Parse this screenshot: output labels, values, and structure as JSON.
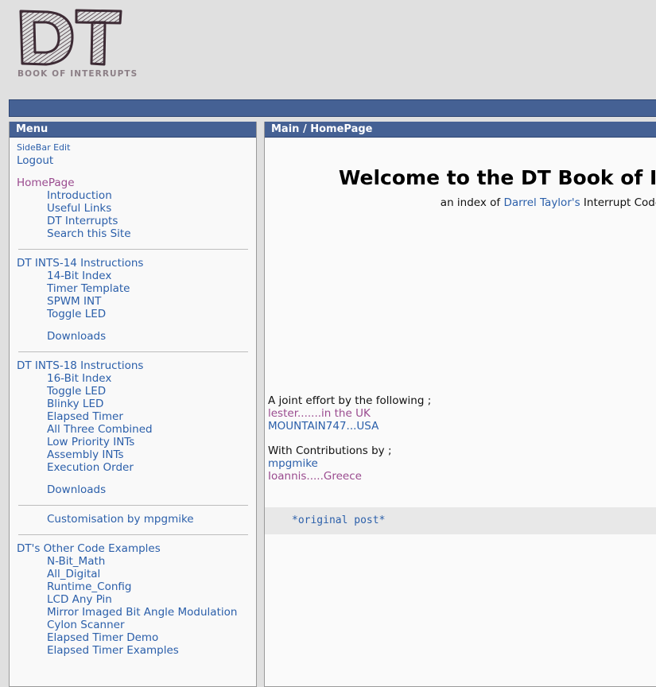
{
  "logo": {
    "mark_text": "DT",
    "tagline": "BOOK OF INTERRUPTS",
    "ink_color": "#3d2b35",
    "tagline_color": "#8c7f86"
  },
  "theme": {
    "page_background": "#e0e0e0",
    "bar_blue": "#456194",
    "bar_border": "#2f4672",
    "panel_background": "#f9f9f9",
    "link_blue": "#2b5faa",
    "link_visited_purple": "#9a4b8f",
    "code_background": "#e8e8e8"
  },
  "sidebar": {
    "title": "Menu",
    "groups": [
      {
        "items": [
          {
            "label": "SideBar Edit",
            "style": "small",
            "indent": false,
            "visited": false
          },
          {
            "label": "Logout",
            "style": "normal",
            "indent": false,
            "visited": false
          },
          {
            "label": "",
            "style": "spacer",
            "indent": false,
            "visited": false
          },
          {
            "label": "HomePage",
            "style": "normal",
            "indent": false,
            "visited": true
          },
          {
            "label": "Introduction",
            "style": "normal",
            "indent": true,
            "visited": false
          },
          {
            "label": "Useful Links",
            "style": "normal",
            "indent": true,
            "visited": false
          },
          {
            "label": "DT Interrupts",
            "style": "normal",
            "indent": true,
            "visited": false
          },
          {
            "label": "Search this Site",
            "style": "normal",
            "indent": true,
            "visited": false
          }
        ]
      },
      {
        "items": [
          {
            "label": "DT INTS-14 Instructions",
            "style": "normal",
            "indent": false,
            "visited": false
          },
          {
            "label": "14-Bit Index",
            "style": "normal",
            "indent": true,
            "visited": false
          },
          {
            "label": "Timer Template",
            "style": "normal",
            "indent": true,
            "visited": false
          },
          {
            "label": "SPWM INT",
            "style": "normal",
            "indent": true,
            "visited": false
          },
          {
            "label": "Toggle LED",
            "style": "normal",
            "indent": true,
            "visited": false
          },
          {
            "label": "",
            "style": "spacer",
            "indent": false,
            "visited": false
          },
          {
            "label": "Downloads",
            "style": "normal",
            "indent": true,
            "visited": false
          }
        ]
      },
      {
        "items": [
          {
            "label": "DT INTS-18 Instructions",
            "style": "normal",
            "indent": false,
            "visited": false
          },
          {
            "label": "16-Bit Index",
            "style": "normal",
            "indent": true,
            "visited": false
          },
          {
            "label": "Toggle LED",
            "style": "normal",
            "indent": true,
            "visited": false
          },
          {
            "label": "Blinky LED",
            "style": "normal",
            "indent": true,
            "visited": false
          },
          {
            "label": "Elapsed Timer",
            "style": "normal",
            "indent": true,
            "visited": false
          },
          {
            "label": "All Three Combined",
            "style": "normal",
            "indent": true,
            "visited": false
          },
          {
            "label": "Low Priority INTs",
            "style": "normal",
            "indent": true,
            "visited": false
          },
          {
            "label": "Assembly INTs",
            "style": "normal",
            "indent": true,
            "visited": false
          },
          {
            "label": "Execution Order",
            "style": "normal",
            "indent": true,
            "visited": false
          },
          {
            "label": "",
            "style": "spacer",
            "indent": false,
            "visited": false
          },
          {
            "label": "Downloads",
            "style": "normal",
            "indent": true,
            "visited": false
          }
        ]
      },
      {
        "items": [
          {
            "label": "Customisation by mpgmike",
            "style": "normal",
            "indent": true,
            "visited": false
          }
        ]
      },
      {
        "items": [
          {
            "label": "DT's Other Code Examples",
            "style": "normal",
            "indent": false,
            "visited": false
          },
          {
            "label": "N-Bit_Math",
            "style": "normal",
            "indent": true,
            "visited": false
          },
          {
            "label": "All_Digital",
            "style": "normal",
            "indent": true,
            "visited": false
          },
          {
            "label": "Runtime_Config",
            "style": "normal",
            "indent": true,
            "visited": false
          },
          {
            "label": "LCD Any Pin",
            "style": "normal",
            "indent": true,
            "visited": false
          },
          {
            "label": "Mirror Imaged Bit Angle Modulation",
            "style": "normal",
            "indent": true,
            "visited": false
          },
          {
            "label": "Cylon Scanner",
            "style": "normal",
            "indent": true,
            "visited": false
          },
          {
            "label": "Elapsed Timer Demo",
            "style": "normal",
            "indent": true,
            "visited": false
          },
          {
            "label": "Elapsed Timer Examples",
            "style": "normal",
            "indent": true,
            "visited": false
          }
        ]
      }
    ]
  },
  "main": {
    "breadcrumb": "Main / HomePage",
    "welcome_heading": "Welcome to the DT Book of Interrupts",
    "subline_prefix": "an index of ",
    "subline_link": "Darrel Taylor's",
    "subline_suffix": " Interrupt Code",
    "credits": {
      "joint_effort_heading": "A joint effort by the following ;",
      "authors": [
        {
          "label": "lester.......in the UK",
          "visited": true
        },
        {
          "label": "MOUNTAIN747...USA",
          "visited": false
        }
      ],
      "contributions_heading": "With Contributions by ;",
      "contributors": [
        {
          "label": "mpgmike",
          "visited": false
        },
        {
          "label": "Ioannis.....Greece",
          "visited": true
        }
      ]
    },
    "code_block": "*original post*"
  }
}
